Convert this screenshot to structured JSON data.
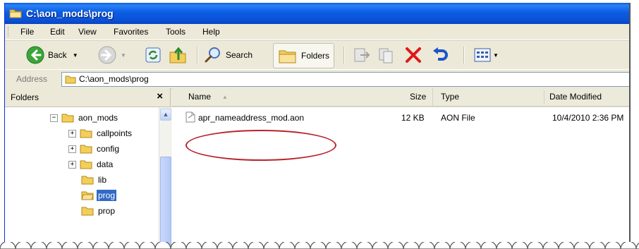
{
  "window": {
    "title": "C:\\aon_mods\\prog"
  },
  "menu": [
    "File",
    "Edit",
    "View",
    "Favorites",
    "Tools",
    "Help"
  ],
  "toolbar": {
    "back_label": "Back",
    "search_label": "Search",
    "folders_label": "Folders"
  },
  "address": {
    "label": "Address",
    "value": "C:\\aon_mods\\prog"
  },
  "folders_pane": {
    "title": "Folders",
    "close_glyph": "×",
    "tree": [
      {
        "label": "aon_mods",
        "expander": "−"
      },
      {
        "label": "callpoints",
        "expander": "+"
      },
      {
        "label": "config",
        "expander": "+"
      },
      {
        "label": "data",
        "expander": "+"
      },
      {
        "label": "lib",
        "expander": ""
      },
      {
        "label": "prog",
        "expander": "",
        "selected": true
      },
      {
        "label": "prop",
        "expander": ""
      }
    ]
  },
  "file_list": {
    "columns": {
      "name": "Name",
      "size": "Size",
      "type": "Type",
      "modified": "Date Modified"
    },
    "rows": [
      {
        "name": "apr_nameaddress_mod.aon",
        "size": "12 KB",
        "type": "AON File",
        "modified": "10/4/2010 2:36 PM"
      }
    ]
  },
  "colors": {
    "title_bar": "#0a5de4",
    "selection": "#316ac5",
    "highlight_ellipse": "#b8232c",
    "window_bg": "#ece9d8"
  }
}
